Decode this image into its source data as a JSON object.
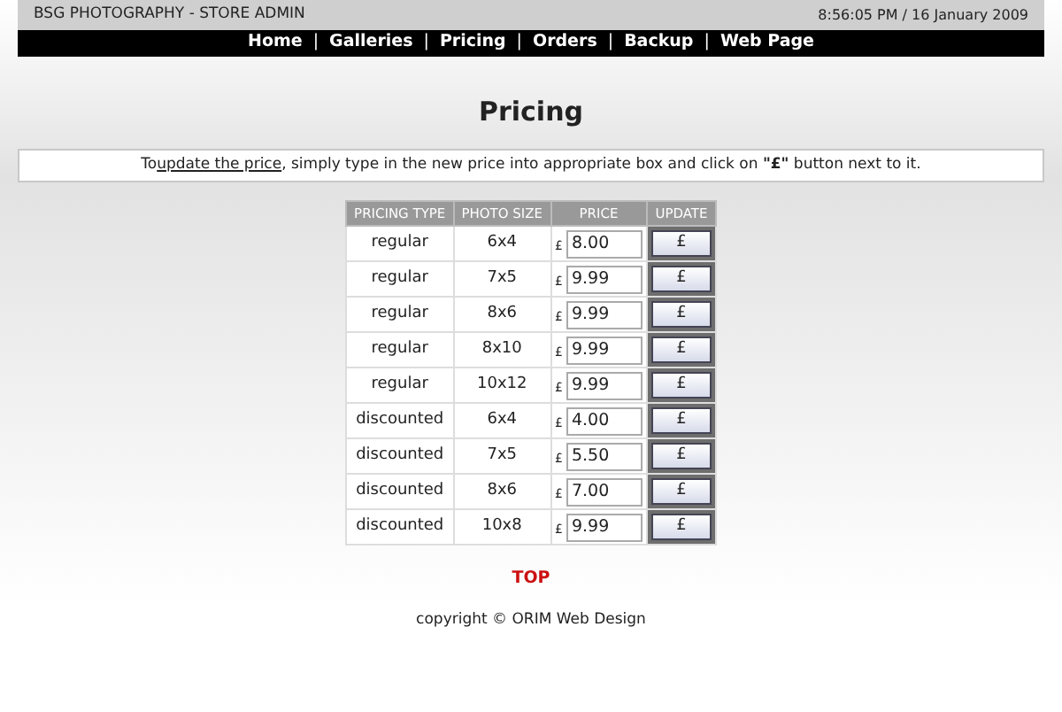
{
  "header": {
    "title": "BSG PHOTOGRAPHY - STORE ADMIN",
    "datetime": "8:56:05 PM / 16 January 2009"
  },
  "nav": [
    {
      "kind": "link",
      "label": "Home"
    },
    {
      "kind": "separator",
      "label": "|"
    },
    {
      "kind": "link",
      "label": "Galleries"
    },
    {
      "kind": "separator",
      "label": "|"
    },
    {
      "kind": "link",
      "label": "Pricing"
    },
    {
      "kind": "separator",
      "label": "|"
    },
    {
      "kind": "link",
      "label": "Orders"
    },
    {
      "kind": "separator",
      "label": "|"
    },
    {
      "kind": "link",
      "label": "Backup"
    },
    {
      "kind": "separator",
      "label": "|"
    },
    {
      "kind": "link",
      "label": "Web Page"
    }
  ],
  "page_title": "Pricing",
  "intro": {
    "before": "To ",
    "link": "update the price",
    "after": ", simply type in the new price into appropriate box and click on **\"£\"** button next to it."
  },
  "table": {
    "columns": [
      "PRICING TYPE",
      "PHOTO SIZE",
      "PRICE",
      "UPDATE"
    ],
    "rows": [
      {
        "type": "regular",
        "size": "6x4",
        "currency": "£",
        "price": "8.00",
        "button": "£"
      },
      {
        "type": "regular",
        "size": "7x5",
        "currency": "£",
        "price": "9.99",
        "button": "£"
      },
      {
        "type": "regular",
        "size": "8x6",
        "currency": "£",
        "price": "9.99",
        "button": "£"
      },
      {
        "type": "regular",
        "size": "8x10",
        "currency": "£",
        "price": "9.99",
        "button": "£"
      },
      {
        "type": "regular",
        "size": "10x12",
        "currency": "£",
        "price": "9.99",
        "button": "£"
      },
      {
        "type": "discounted",
        "size": "6x4",
        "currency": "£",
        "price": "4.00",
        "button": "£"
      },
      {
        "type": "discounted",
        "size": "7x5",
        "currency": "£",
        "price": "5.50",
        "button": "£"
      },
      {
        "type": "discounted",
        "size": "8x6",
        "currency": "£",
        "price": "7.00",
        "button": "£"
      },
      {
        "type": "discounted",
        "size": "10x8",
        "currency": "£",
        "price": "9.99",
        "button": "£"
      }
    ]
  },
  "top_link": "TOP",
  "copyright": "copyright © ORIM Web Design"
}
